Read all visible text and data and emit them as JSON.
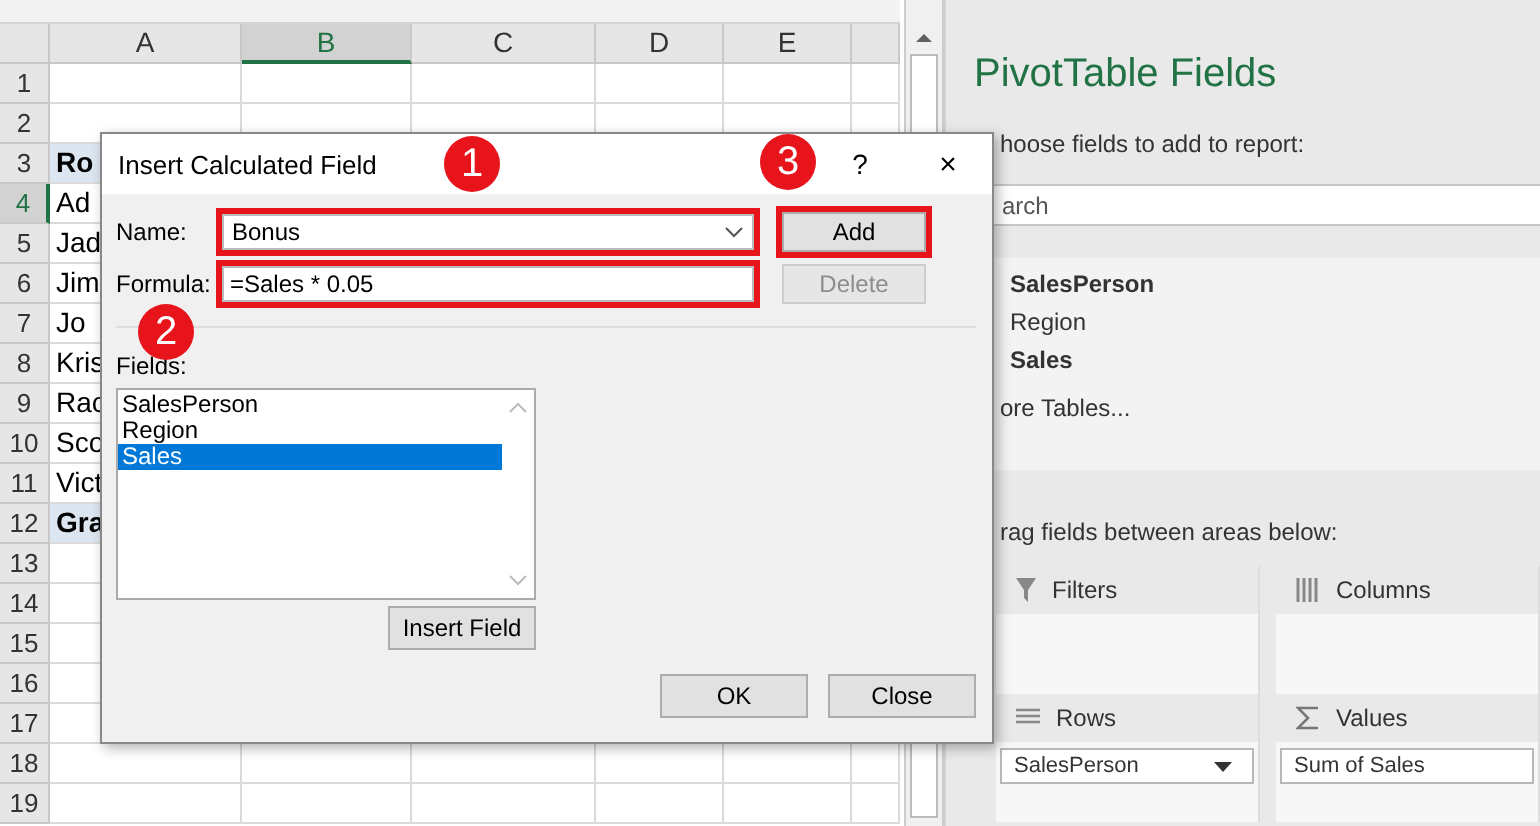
{
  "sheet": {
    "columns": [
      {
        "label": "A",
        "selected": false
      },
      {
        "label": "B",
        "selected": true
      },
      {
        "label": "C",
        "selected": false
      },
      {
        "label": "D",
        "selected": false
      },
      {
        "label": "E",
        "selected": false
      }
    ],
    "rows": [
      {
        "number": "1",
        "selected": false
      },
      {
        "number": "2",
        "selected": false
      },
      {
        "number": "3",
        "selected": false,
        "cell": {
          "text": "Ro",
          "kind": "header"
        }
      },
      {
        "number": "4",
        "selected": true,
        "cell": {
          "text": "Ad",
          "kind": "item"
        }
      },
      {
        "number": "5",
        "selected": false,
        "cell": {
          "text": "Jad",
          "kind": "item"
        }
      },
      {
        "number": "6",
        "selected": false,
        "cell": {
          "text": "Jim",
          "kind": "item"
        }
      },
      {
        "number": "7",
        "selected": false,
        "cell": {
          "text": "Jo",
          "kind": "item"
        }
      },
      {
        "number": "8",
        "selected": false,
        "cell": {
          "text": "Kris",
          "kind": "item"
        }
      },
      {
        "number": "9",
        "selected": false,
        "cell": {
          "text": "Rac",
          "kind": "item"
        }
      },
      {
        "number": "10",
        "selected": false,
        "cell": {
          "text": "Sco",
          "kind": "item"
        }
      },
      {
        "number": "11",
        "selected": false,
        "cell": {
          "text": "Vict",
          "kind": "item"
        }
      },
      {
        "number": "12",
        "selected": false,
        "cell": {
          "text": "Gra",
          "kind": "header"
        }
      },
      {
        "number": "13",
        "selected": false
      },
      {
        "number": "14",
        "selected": false
      },
      {
        "number": "15",
        "selected": false
      },
      {
        "number": "16",
        "selected": false
      },
      {
        "number": "17",
        "selected": false
      },
      {
        "number": "18",
        "selected": false
      },
      {
        "number": "19",
        "selected": false
      }
    ]
  },
  "dialog": {
    "title": "Insert Calculated Field",
    "help_button": "?",
    "close_button": "×",
    "name_field": {
      "label": "Name:",
      "value": "Bonus"
    },
    "formula_field": {
      "label": "Formula:",
      "value": "=Sales * 0.05"
    },
    "side_buttons": [
      {
        "label": "Add",
        "disabled": false
      },
      {
        "label": "Delete",
        "disabled": true
      }
    ],
    "fields_label": "Fields:",
    "fields": [
      {
        "label": "SalesPerson",
        "selected": false
      },
      {
        "label": "Region",
        "selected": false
      },
      {
        "label": "Sales",
        "selected": true
      }
    ],
    "insert_field_button": "Insert Field",
    "buttons": [
      "OK",
      "Close"
    ]
  },
  "callouts": [
    "1",
    "2",
    "3"
  ],
  "pane": {
    "title": "PivotTable Fields",
    "instruction": "hoose fields to add to report:",
    "search": {
      "placeholder": "arch"
    },
    "fields": [
      {
        "label": "SalesPerson",
        "bold": true
      },
      {
        "label": "Region",
        "bold": false
      },
      {
        "label": "Sales",
        "bold": true
      }
    ],
    "more_tables": "ore Tables...",
    "drag_instruction": "rag fields between areas below:",
    "areas": [
      {
        "label": "Filters",
        "kind": "filters"
      },
      {
        "label": "Columns",
        "kind": "columns"
      },
      {
        "label": "Rows",
        "kind": "rows",
        "items": [
          "SalesPerson"
        ]
      },
      {
        "label": "Values",
        "kind": "values",
        "items": [
          "Sum of Sales"
        ]
      }
    ]
  }
}
